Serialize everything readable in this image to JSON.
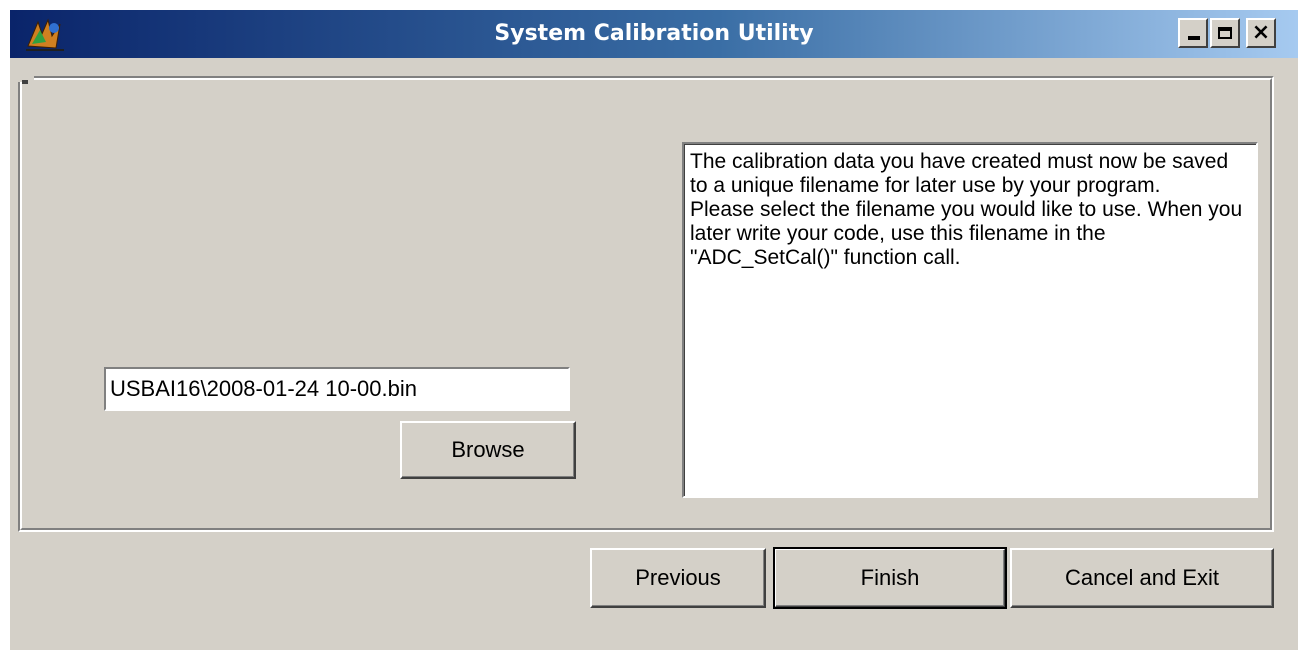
{
  "window": {
    "title": "System Calibration Utility"
  },
  "title_buttons": {
    "minimize_icon": "minimize-icon",
    "maximize_icon": "maximize-icon",
    "close_icon": "close-icon",
    "close_glyph": "×"
  },
  "file": {
    "value": "USBAI16\\2008-01-24 10-00.bin"
  },
  "buttons": {
    "browse_label": "Browse",
    "previous_label": "Previous",
    "finish_label": "Finish",
    "cancel_label": "Cancel and Exit"
  },
  "message": {
    "text": "The calibration data you have created must now be saved to a unique filename for later use by your program.\nPlease select the filename you would like to use. When you later write your code, use this filename in the \"ADC_SetCal()\" function call."
  },
  "colors": {
    "titlebar_start": "#0a246a",
    "titlebar_end": "#a6caf0",
    "face": "#d4d0c8"
  }
}
